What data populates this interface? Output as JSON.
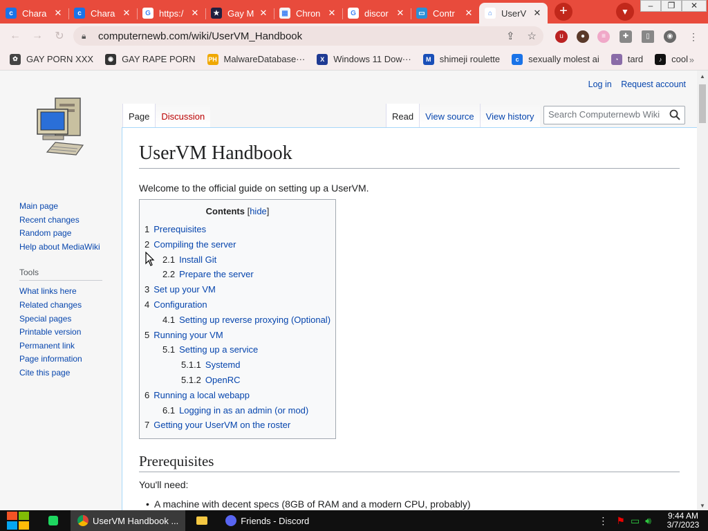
{
  "browser": {
    "tabs": [
      {
        "label": "Chara",
        "icon": "character-ai-icon",
        "color": "#1a73e8",
        "glyph": "c"
      },
      {
        "label": "Chara",
        "icon": "character-ai-icon",
        "color": "#1a73e8",
        "glyph": "c"
      },
      {
        "label": "https:/",
        "icon": "google-icon",
        "color": "#ffffff",
        "glyph": "G"
      },
      {
        "label": "Gay M",
        "icon": "site-icon",
        "color": "#202040",
        "glyph": "★"
      },
      {
        "label": "Chron",
        "icon": "site-icon",
        "color": "#f4f4f4",
        "glyph": "▦"
      },
      {
        "label": "discor",
        "icon": "google-icon",
        "color": "#ffffff",
        "glyph": "G"
      },
      {
        "label": "Contr",
        "icon": "monitor-icon",
        "color": "#2b8fd6",
        "glyph": "▭"
      },
      {
        "label": "UserV",
        "icon": "wiki-favicon",
        "color": "#ffffff",
        "glyph": "⌂"
      }
    ],
    "close_glyph": "✕",
    "new_tab_glyph": "+",
    "address": "computernewb.com/wiki/UserVM_Handbook",
    "bookmarks": [
      {
        "label": "GAY PORN XXX",
        "icon": "bookmark-icon",
        "color": "#444444",
        "glyph": "✿"
      },
      {
        "label": "GAY RAPE PORN",
        "icon": "bookmark-icon",
        "color": "#333333",
        "glyph": "◉"
      },
      {
        "label": "MalwareDatabase···",
        "icon": "ph-icon",
        "color": "#f0a800",
        "glyph": "PH"
      },
      {
        "label": "Windows 11 Dow···",
        "icon": "x-icon",
        "color": "#1f3a93",
        "glyph": "X"
      },
      {
        "label": "shimeji roulette",
        "icon": "mft-icon",
        "color": "#1a4fb8",
        "glyph": "M"
      },
      {
        "label": "sexually molest ai",
        "icon": "character-ai-icon",
        "color": "#1a73e8",
        "glyph": "c"
      },
      {
        "label": "tard",
        "icon": "bookmark-icon",
        "color": "#8a6ca8",
        "glyph": "◔"
      },
      {
        "label": "cool",
        "icon": "tiktok-icon",
        "color": "#111111",
        "glyph": "♪"
      }
    ]
  },
  "wiki": {
    "personal": {
      "login": "Log in",
      "request": "Request account"
    },
    "nav": [
      "Main page",
      "Recent changes",
      "Random page",
      "Help about MediaWiki"
    ],
    "tools_heading": "Tools",
    "tools": [
      "What links here",
      "Related changes",
      "Special pages",
      "Printable version",
      "Permanent link",
      "Page information",
      "Cite this page"
    ],
    "tabs_left": [
      "Page",
      "Discussion"
    ],
    "tabs_right": [
      "Read",
      "View source",
      "View history"
    ],
    "search_placeholder": "Search Computernewb Wiki",
    "title": "UserVM Handbook",
    "intro": "Welcome to the official guide on setting up a UserVM.",
    "toc": {
      "title": "Contents",
      "toggle": "hide",
      "items": [
        {
          "num": "1",
          "text": "Prerequisites",
          "level": 1
        },
        {
          "num": "2",
          "text": "Compiling the server",
          "level": 1
        },
        {
          "num": "2.1",
          "text": "Install Git",
          "level": 2
        },
        {
          "num": "2.2",
          "text": "Prepare the server",
          "level": 2
        },
        {
          "num": "3",
          "text": "Set up your VM",
          "level": 1
        },
        {
          "num": "4",
          "text": "Configuration",
          "level": 1
        },
        {
          "num": "4.1",
          "text": "Setting up reverse proxying (Optional)",
          "level": 2
        },
        {
          "num": "5",
          "text": "Running your VM",
          "level": 1
        },
        {
          "num": "5.1",
          "text": "Setting up a service",
          "level": 2
        },
        {
          "num": "5.1.1",
          "text": "Systemd",
          "level": 3
        },
        {
          "num": "5.1.2",
          "text": "OpenRC",
          "level": 3
        },
        {
          "num": "6",
          "text": "Running a local webapp",
          "level": 1
        },
        {
          "num": "6.1",
          "text": "Logging in as an admin (or mod)",
          "level": 2
        },
        {
          "num": "7",
          "text": "Getting your UserVM on the roster",
          "level": 1
        }
      ]
    },
    "section_heading": "Prerequisites",
    "needs": "You'll need:",
    "bullet_partial": "A machine with decent specs (8GB of RAM and a modern CPU, probably)"
  },
  "taskbar": {
    "apps": [
      {
        "label": "UserVM Handbook ...",
        "icon": "chrome-icon",
        "active": true
      },
      {
        "label": "Friends - Discord",
        "icon": "discord-icon",
        "active": false
      }
    ],
    "time": "9:44 AM",
    "date": "3/7/2023"
  },
  "colors": {
    "accent": "#e84b3c",
    "link": "#0645ad",
    "redlink": "#ba0000"
  }
}
